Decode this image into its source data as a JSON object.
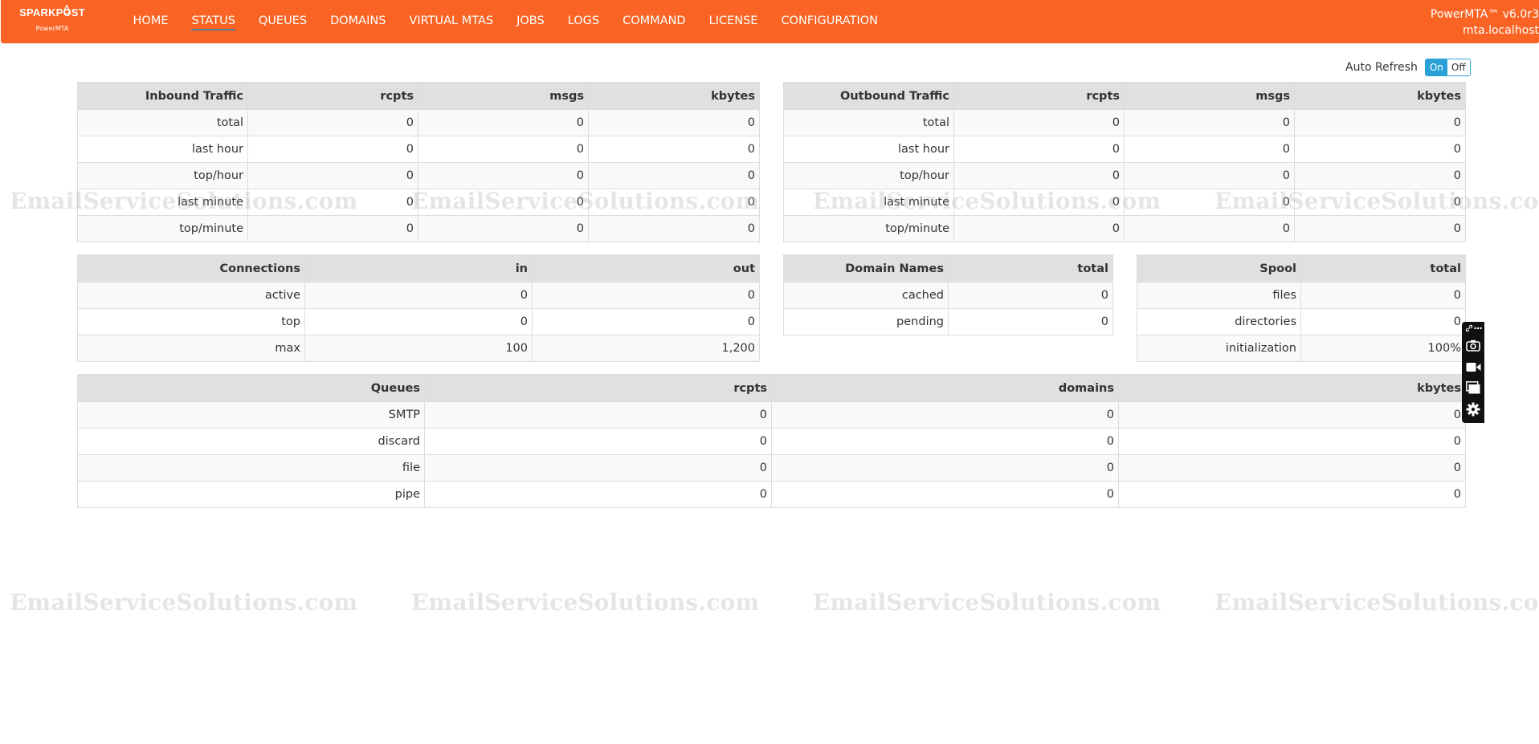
{
  "brand": {
    "name": "SPARKPOST",
    "product": "PowerMTA"
  },
  "nav": [
    {
      "label": "HOME",
      "active": false
    },
    {
      "label": "STATUS",
      "active": true
    },
    {
      "label": "QUEUES",
      "active": false
    },
    {
      "label": "DOMAINS",
      "active": false
    },
    {
      "label": "VIRTUAL MTAS",
      "active": false
    },
    {
      "label": "JOBS",
      "active": false
    },
    {
      "label": "LOGS",
      "active": false
    },
    {
      "label": "COMMAND",
      "active": false
    },
    {
      "label": "LICENSE",
      "active": false
    },
    {
      "label": "CONFIGURATION",
      "active": false
    }
  ],
  "version": {
    "line1": "PowerMTA™ v6.0r3",
    "line2": "mta.localhost"
  },
  "auto_refresh": {
    "label": "Auto Refresh",
    "on": "On",
    "off": "Off",
    "state": "On"
  },
  "inbound": {
    "headers": [
      "Inbound Traffic",
      "rcpts",
      "msgs",
      "kbytes"
    ],
    "rows": [
      [
        "total",
        "0",
        "0",
        "0"
      ],
      [
        "last hour",
        "0",
        "0",
        "0"
      ],
      [
        "top/hour",
        "0",
        "0",
        "0"
      ],
      [
        "last minute",
        "0",
        "0",
        "0"
      ],
      [
        "top/minute",
        "0",
        "0",
        "0"
      ]
    ]
  },
  "outbound": {
    "headers": [
      "Outbound Traffic",
      "rcpts",
      "msgs",
      "kbytes"
    ],
    "rows": [
      [
        "total",
        "0",
        "0",
        "0"
      ],
      [
        "last hour",
        "0",
        "0",
        "0"
      ],
      [
        "top/hour",
        "0",
        "0",
        "0"
      ],
      [
        "last minute",
        "0",
        "0",
        "0"
      ],
      [
        "top/minute",
        "0",
        "0",
        "0"
      ]
    ]
  },
  "connections": {
    "headers": [
      "Connections",
      "in",
      "out"
    ],
    "rows": [
      [
        "active",
        "0",
        "0"
      ],
      [
        "top",
        "0",
        "0"
      ],
      [
        "max",
        "100",
        "1,200"
      ]
    ]
  },
  "domain_names": {
    "headers": [
      "Domain Names",
      "total"
    ],
    "rows": [
      [
        "cached",
        "0"
      ],
      [
        "pending",
        "0"
      ]
    ]
  },
  "spool": {
    "headers": [
      "Spool",
      "total"
    ],
    "rows": [
      [
        "files",
        "0"
      ],
      [
        "directories",
        "0"
      ],
      [
        "initialization",
        "100%"
      ]
    ]
  },
  "queues": {
    "headers": [
      "Queues",
      "rcpts",
      "domains",
      "kbytes"
    ],
    "rows": [
      [
        "SMTP",
        "0",
        "0",
        "0"
      ],
      [
        "discard",
        "0",
        "0",
        "0"
      ],
      [
        "file",
        "0",
        "0",
        "0"
      ],
      [
        "pipe",
        "0",
        "0",
        "0"
      ]
    ]
  },
  "watermark": "EmailServiceSolutions.com",
  "side_tools": [
    "link-icon",
    "more-icon",
    "camera-icon",
    "video-icon",
    "window-icon",
    "gear-icon"
  ],
  "colors": {
    "topbar": "#f96424",
    "toggle_on": "#2aa1d6",
    "header_row": "#e0e0e0"
  }
}
